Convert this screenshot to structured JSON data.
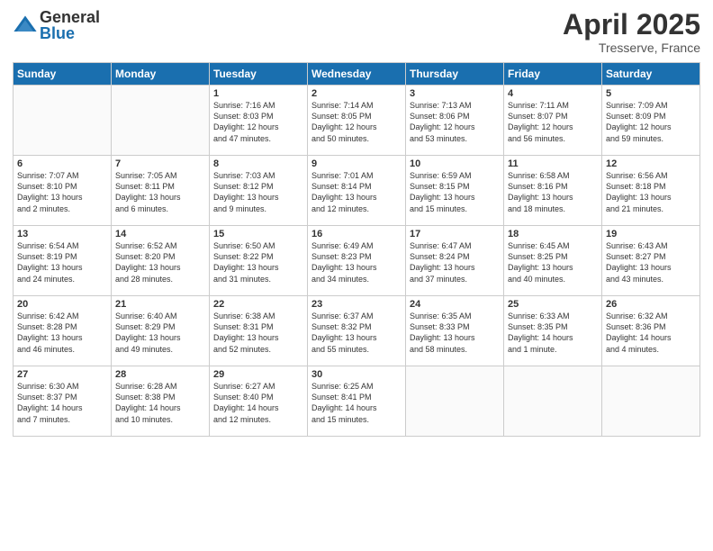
{
  "logo": {
    "general": "General",
    "blue": "Blue"
  },
  "title": {
    "month": "April 2025",
    "location": "Tresserve, France"
  },
  "headers": [
    "Sunday",
    "Monday",
    "Tuesday",
    "Wednesday",
    "Thursday",
    "Friday",
    "Saturday"
  ],
  "weeks": [
    [
      {
        "day": "",
        "info": ""
      },
      {
        "day": "",
        "info": ""
      },
      {
        "day": "1",
        "info": "Sunrise: 7:16 AM\nSunset: 8:03 PM\nDaylight: 12 hours\nand 47 minutes."
      },
      {
        "day": "2",
        "info": "Sunrise: 7:14 AM\nSunset: 8:05 PM\nDaylight: 12 hours\nand 50 minutes."
      },
      {
        "day": "3",
        "info": "Sunrise: 7:13 AM\nSunset: 8:06 PM\nDaylight: 12 hours\nand 53 minutes."
      },
      {
        "day": "4",
        "info": "Sunrise: 7:11 AM\nSunset: 8:07 PM\nDaylight: 12 hours\nand 56 minutes."
      },
      {
        "day": "5",
        "info": "Sunrise: 7:09 AM\nSunset: 8:09 PM\nDaylight: 12 hours\nand 59 minutes."
      }
    ],
    [
      {
        "day": "6",
        "info": "Sunrise: 7:07 AM\nSunset: 8:10 PM\nDaylight: 13 hours\nand 2 minutes."
      },
      {
        "day": "7",
        "info": "Sunrise: 7:05 AM\nSunset: 8:11 PM\nDaylight: 13 hours\nand 6 minutes."
      },
      {
        "day": "8",
        "info": "Sunrise: 7:03 AM\nSunset: 8:12 PM\nDaylight: 13 hours\nand 9 minutes."
      },
      {
        "day": "9",
        "info": "Sunrise: 7:01 AM\nSunset: 8:14 PM\nDaylight: 13 hours\nand 12 minutes."
      },
      {
        "day": "10",
        "info": "Sunrise: 6:59 AM\nSunset: 8:15 PM\nDaylight: 13 hours\nand 15 minutes."
      },
      {
        "day": "11",
        "info": "Sunrise: 6:58 AM\nSunset: 8:16 PM\nDaylight: 13 hours\nand 18 minutes."
      },
      {
        "day": "12",
        "info": "Sunrise: 6:56 AM\nSunset: 8:18 PM\nDaylight: 13 hours\nand 21 minutes."
      }
    ],
    [
      {
        "day": "13",
        "info": "Sunrise: 6:54 AM\nSunset: 8:19 PM\nDaylight: 13 hours\nand 24 minutes."
      },
      {
        "day": "14",
        "info": "Sunrise: 6:52 AM\nSunset: 8:20 PM\nDaylight: 13 hours\nand 28 minutes."
      },
      {
        "day": "15",
        "info": "Sunrise: 6:50 AM\nSunset: 8:22 PM\nDaylight: 13 hours\nand 31 minutes."
      },
      {
        "day": "16",
        "info": "Sunrise: 6:49 AM\nSunset: 8:23 PM\nDaylight: 13 hours\nand 34 minutes."
      },
      {
        "day": "17",
        "info": "Sunrise: 6:47 AM\nSunset: 8:24 PM\nDaylight: 13 hours\nand 37 minutes."
      },
      {
        "day": "18",
        "info": "Sunrise: 6:45 AM\nSunset: 8:25 PM\nDaylight: 13 hours\nand 40 minutes."
      },
      {
        "day": "19",
        "info": "Sunrise: 6:43 AM\nSunset: 8:27 PM\nDaylight: 13 hours\nand 43 minutes."
      }
    ],
    [
      {
        "day": "20",
        "info": "Sunrise: 6:42 AM\nSunset: 8:28 PM\nDaylight: 13 hours\nand 46 minutes."
      },
      {
        "day": "21",
        "info": "Sunrise: 6:40 AM\nSunset: 8:29 PM\nDaylight: 13 hours\nand 49 minutes."
      },
      {
        "day": "22",
        "info": "Sunrise: 6:38 AM\nSunset: 8:31 PM\nDaylight: 13 hours\nand 52 minutes."
      },
      {
        "day": "23",
        "info": "Sunrise: 6:37 AM\nSunset: 8:32 PM\nDaylight: 13 hours\nand 55 minutes."
      },
      {
        "day": "24",
        "info": "Sunrise: 6:35 AM\nSunset: 8:33 PM\nDaylight: 13 hours\nand 58 minutes."
      },
      {
        "day": "25",
        "info": "Sunrise: 6:33 AM\nSunset: 8:35 PM\nDaylight: 14 hours\nand 1 minute."
      },
      {
        "day": "26",
        "info": "Sunrise: 6:32 AM\nSunset: 8:36 PM\nDaylight: 14 hours\nand 4 minutes."
      }
    ],
    [
      {
        "day": "27",
        "info": "Sunrise: 6:30 AM\nSunset: 8:37 PM\nDaylight: 14 hours\nand 7 minutes."
      },
      {
        "day": "28",
        "info": "Sunrise: 6:28 AM\nSunset: 8:38 PM\nDaylight: 14 hours\nand 10 minutes."
      },
      {
        "day": "29",
        "info": "Sunrise: 6:27 AM\nSunset: 8:40 PM\nDaylight: 14 hours\nand 12 minutes."
      },
      {
        "day": "30",
        "info": "Sunrise: 6:25 AM\nSunset: 8:41 PM\nDaylight: 14 hours\nand 15 minutes."
      },
      {
        "day": "",
        "info": ""
      },
      {
        "day": "",
        "info": ""
      },
      {
        "day": "",
        "info": ""
      }
    ]
  ]
}
